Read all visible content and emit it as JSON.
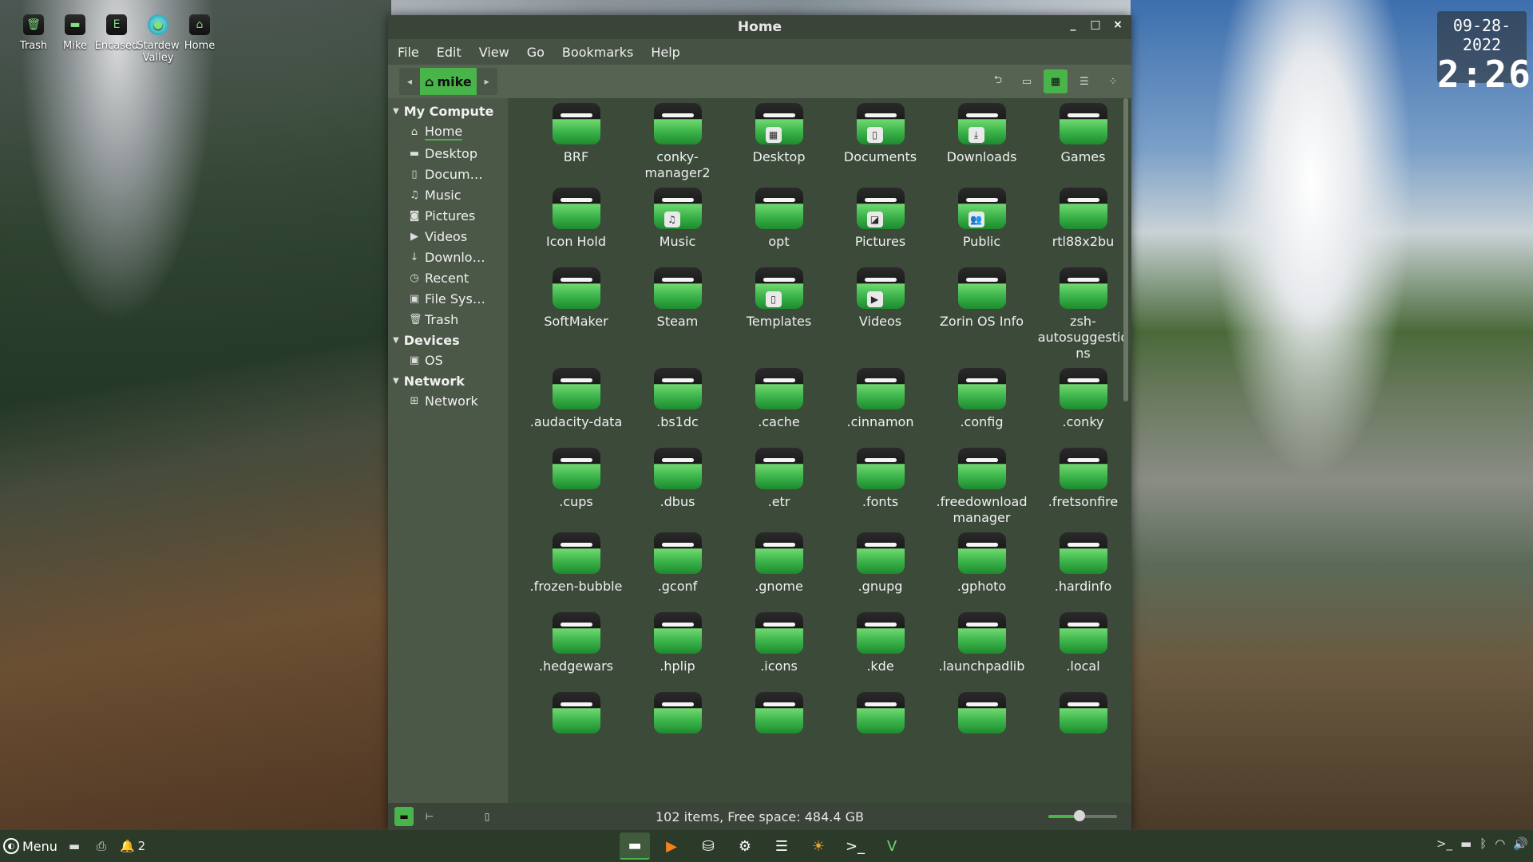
{
  "desktop": {
    "icons": [
      {
        "label": "Trash"
      },
      {
        "label": "Mike"
      },
      {
        "label": "Encased"
      },
      {
        "label": "Stardew Valley"
      },
      {
        "label": "Home"
      }
    ],
    "clock": {
      "date": "09-28-2022",
      "time": "2:26"
    }
  },
  "window": {
    "title": "Home",
    "controls": {
      "minimize": "_",
      "maximize": "□",
      "close": "×"
    }
  },
  "menubar": [
    "File",
    "Edit",
    "View",
    "Go",
    "Bookmarks",
    "Help"
  ],
  "toolbar": {
    "breadcrumb": "mike",
    "view_mode": "icon-view"
  },
  "sidebar": {
    "sections": [
      {
        "title": "My Compute",
        "items": [
          {
            "label": "Home",
            "icon": "home-icon"
          },
          {
            "label": "Desktop",
            "icon": "folder-icon"
          },
          {
            "label": "Docum…",
            "icon": "document-icon"
          },
          {
            "label": "Music",
            "icon": "music-icon"
          },
          {
            "label": "Pictures",
            "icon": "camera-icon"
          },
          {
            "label": "Videos",
            "icon": "video-icon"
          },
          {
            "label": "Downlo…",
            "icon": "download-icon"
          },
          {
            "label": "Recent",
            "icon": "clock-icon"
          },
          {
            "label": "File Sys…",
            "icon": "drive-icon"
          },
          {
            "label": "Trash",
            "icon": "trash-icon"
          }
        ]
      },
      {
        "title": "Devices",
        "items": [
          {
            "label": "OS",
            "icon": "drive-icon"
          }
        ]
      },
      {
        "title": "Network",
        "items": [
          {
            "label": "Network",
            "icon": "network-icon"
          }
        ]
      }
    ]
  },
  "files": [
    {
      "name": "BRF"
    },
    {
      "name": "conky-manager2"
    },
    {
      "name": "Desktop",
      "emblem": "desktop"
    },
    {
      "name": "Documents",
      "emblem": "doc"
    },
    {
      "name": "Downloads",
      "emblem": "down"
    },
    {
      "name": "Games"
    },
    {
      "name": "Icon Hold"
    },
    {
      "name": "Music",
      "emblem": "music"
    },
    {
      "name": "opt"
    },
    {
      "name": "Pictures",
      "emblem": "pic"
    },
    {
      "name": "Public",
      "emblem": "people"
    },
    {
      "name": "rtl88x2bu"
    },
    {
      "name": "SoftMaker"
    },
    {
      "name": "Steam"
    },
    {
      "name": "Templates",
      "emblem": "doc"
    },
    {
      "name": "Videos",
      "emblem": "play"
    },
    {
      "name": "Zorin OS Info"
    },
    {
      "name": "zsh-autosuggestions"
    },
    {
      "name": ".audacity-data"
    },
    {
      "name": ".bs1dc"
    },
    {
      "name": ".cache"
    },
    {
      "name": ".cinnamon"
    },
    {
      "name": ".config"
    },
    {
      "name": ".conky"
    },
    {
      "name": ".cups"
    },
    {
      "name": ".dbus"
    },
    {
      "name": ".etr"
    },
    {
      "name": ".fonts"
    },
    {
      "name": ".freedownloadmanager"
    },
    {
      "name": ".fretsonfire"
    },
    {
      "name": ".frozen-bubble"
    },
    {
      "name": ".gconf"
    },
    {
      "name": ".gnome"
    },
    {
      "name": ".gnupg"
    },
    {
      "name": ".gphoto"
    },
    {
      "name": ".hardinfo"
    },
    {
      "name": ".hedgewars"
    },
    {
      "name": ".hplip"
    },
    {
      "name": ".icons"
    },
    {
      "name": ".kde"
    },
    {
      "name": ".launchpadlib"
    },
    {
      "name": ".local"
    },
    {
      "name": ""
    },
    {
      "name": ""
    },
    {
      "name": ""
    },
    {
      "name": ""
    },
    {
      "name": ""
    },
    {
      "name": ""
    }
  ],
  "statusbar": {
    "text": "102 items, Free space: 484.4 GB",
    "zoom_level": 0.45
  },
  "taskbar": {
    "menu_label": "Menu",
    "notification_count": "2"
  },
  "colors": {
    "accent": "#49b44a",
    "panel": "#3b4438",
    "sidebar": "#4b5747"
  }
}
